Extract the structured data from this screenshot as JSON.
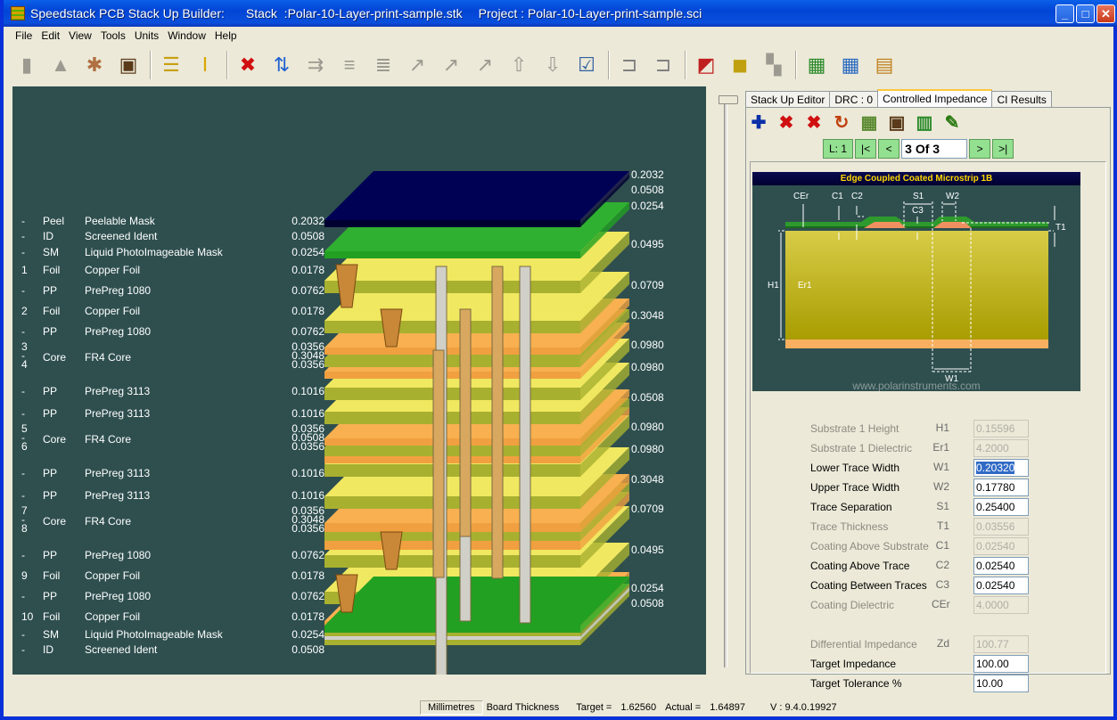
{
  "window": {
    "title_app": "Speedstack PCB Stack Up Builder:",
    "title_stack": "Stack  :Polar-10-Layer-print-sample.stk",
    "title_project": "Project : Polar-10-Layer-print-sample.sci",
    "buttons": {
      "minimize": "_",
      "maximize": "□",
      "close": "✕"
    }
  },
  "menu": [
    "File",
    "Edit",
    "View",
    "Tools",
    "Units",
    "Window",
    "Help"
  ],
  "toolbar": [
    {
      "name": "new-document-icon",
      "glyph": "▮",
      "enabled": false
    },
    {
      "name": "wizard-hat-icon",
      "glyph": "▲",
      "enabled": false
    },
    {
      "name": "vitruvian-man-icon",
      "glyph": "✱",
      "enabled": true
    },
    {
      "name": "frame-icon",
      "glyph": "▣",
      "enabled": true
    },
    {
      "sep": true
    },
    {
      "name": "add-layer-icon",
      "glyph": "☰",
      "enabled": true
    },
    {
      "name": "add-via-icon",
      "glyph": "Ⅰ",
      "enabled": true
    },
    {
      "sep": true
    },
    {
      "name": "delete-icon",
      "glyph": "✖",
      "enabled": true
    },
    {
      "name": "swap-layers-icon",
      "glyph": "⇅",
      "enabled": true
    },
    {
      "name": "move-layer-icon",
      "glyph": "⇉",
      "enabled": false
    },
    {
      "name": "layer-shape-icon",
      "glyph": "≡",
      "enabled": false
    },
    {
      "name": "layer-shape2-icon",
      "glyph": "≣",
      "enabled": false
    },
    {
      "name": "arrow-diag1-icon",
      "glyph": "↗",
      "enabled": false
    },
    {
      "name": "arrow-diag2-icon",
      "glyph": "↗",
      "enabled": false
    },
    {
      "name": "arrow-diag3-icon",
      "glyph": "↗",
      "enabled": false
    },
    {
      "name": "move-up-icon",
      "glyph": "⇧",
      "enabled": false
    },
    {
      "name": "move-down-icon",
      "glyph": "⇩",
      "enabled": false
    },
    {
      "name": "checklist-icon",
      "glyph": "☑",
      "enabled": true
    },
    {
      "sep": true
    },
    {
      "name": "clamp-compress-icon",
      "glyph": "⊐",
      "enabled": true
    },
    {
      "name": "clamp-expand-icon",
      "glyph": "⊐",
      "enabled": true
    },
    {
      "sep": true
    },
    {
      "name": "view-2d-icon",
      "glyph": "◩",
      "enabled": true
    },
    {
      "name": "view-3d-icon",
      "glyph": "◼",
      "enabled": true
    },
    {
      "name": "puzzle-icon",
      "glyph": "▚",
      "enabled": false
    },
    {
      "sep": true
    },
    {
      "name": "export-report-icon",
      "glyph": "▦",
      "enabled": true
    },
    {
      "name": "import-report-icon",
      "glyph": "▦",
      "enabled": true
    },
    {
      "name": "spreadsheet-icon",
      "glyph": "▤",
      "enabled": true
    }
  ],
  "stack": {
    "layers": [
      {
        "num": "-",
        "type": "Peel",
        "material": "Peelable Mask",
        "thickness": "0.2032"
      },
      {
        "num": "-",
        "type": "ID",
        "material": "Screened Ident",
        "thickness": "0.0508"
      },
      {
        "num": "-",
        "type": "SM",
        "material": "Liquid PhotoImageable Mask",
        "thickness": "0.0254"
      },
      {
        "num": "1",
        "type": "Foil",
        "material": "Copper Foil",
        "thickness": "0.0178"
      },
      {
        "num": "-",
        "type": "PP",
        "material": "PrePreg 1080",
        "thickness": "0.0762"
      },
      {
        "num": "2",
        "type": "Foil",
        "material": "Copper Foil",
        "thickness": "0.0178"
      },
      {
        "num": "-",
        "type": "PP",
        "material": "PrePreg 1080",
        "thickness": "0.0762"
      },
      {
        "core": true,
        "nums": [
          "3",
          "-",
          "4"
        ],
        "type": "Core",
        "material": "FR4 Core",
        "thickness": [
          "0.0356",
          "0.3048",
          "0.0356"
        ]
      },
      {
        "num": "-",
        "type": "PP",
        "material": "PrePreg 3113",
        "thickness": "0.1016"
      },
      {
        "num": "-",
        "type": "PP",
        "material": "PrePreg 3113",
        "thickness": "0.1016"
      },
      {
        "core": true,
        "nums": [
          "5",
          "-",
          "6"
        ],
        "type": "Core",
        "material": "FR4 Core",
        "thickness": [
          "0.0356",
          "0.0508",
          "0.0356"
        ]
      },
      {
        "num": "-",
        "type": "PP",
        "material": "PrePreg 3113",
        "thickness": "0.1016"
      },
      {
        "num": "-",
        "type": "PP",
        "material": "PrePreg 3113",
        "thickness": "0.1016"
      },
      {
        "core": true,
        "nums": [
          "7",
          "-",
          "8"
        ],
        "type": "Core",
        "material": "FR4 Core",
        "thickness": [
          "0.0356",
          "0.3048",
          "0.0356"
        ]
      },
      {
        "num": "-",
        "type": "PP",
        "material": "PrePreg 1080",
        "thickness": "0.0762"
      },
      {
        "num": "9",
        "type": "Foil",
        "material": "Copper Foil",
        "thickness": "0.0178"
      },
      {
        "num": "-",
        "type": "PP",
        "material": "PrePreg 1080",
        "thickness": "0.0762"
      },
      {
        "num": "10",
        "type": "Foil",
        "material": "Copper Foil",
        "thickness": "0.0178"
      },
      {
        "num": "-",
        "type": "SM",
        "material": "Liquid PhotoImageable Mask",
        "thickness": "0.0254"
      },
      {
        "num": "-",
        "type": "ID",
        "material": "Screened Ident",
        "thickness": "0.0508"
      }
    ],
    "right_labels": [
      "0.2032",
      "0.0508",
      "0.0254",
      "0.0495",
      "0.0709",
      "0.3048",
      "0.0980",
      "0.0980",
      "0.0508",
      "0.0980",
      "0.0980",
      "0.3048",
      "0.0709",
      "0.0495",
      "0.0254",
      "0.0508"
    ],
    "colors": {
      "background": "#2F4F4F",
      "peel": "#000055",
      "mask": "#22A022",
      "prepreg": "#E8E050",
      "core": "#A8B030",
      "copper": "#F0A040",
      "ident": "#D0D0D0"
    }
  },
  "right_panel": {
    "tabs": [
      {
        "label": "Stack Up Editor",
        "active": false
      },
      {
        "label": "DRC : 0",
        "active": false
      },
      {
        "label": "Controlled Impedance",
        "active": true
      },
      {
        "label": "CI Results",
        "active": false
      }
    ],
    "ci_tools": [
      {
        "name": "add-structure-icon",
        "glyph": "✚",
        "color": "#0A2FA8"
      },
      {
        "name": "delete-structure-icon",
        "glyph": "✖",
        "color": "#D01010"
      },
      {
        "name": "delete-all-icon",
        "glyph": "✖",
        "color": "#D01010"
      },
      {
        "name": "refresh-icon",
        "glyph": "↻",
        "color": "#C04010"
      },
      {
        "name": "structure-thumbnail-icon",
        "glyph": "▦",
        "color": "#5A8A30"
      },
      {
        "name": "frame-icon",
        "glyph": "▣",
        "color": "#5A3A1A"
      },
      {
        "name": "goal-seek-icon",
        "glyph": "▥",
        "color": "#2A8A2A"
      },
      {
        "name": "calculate-icon",
        "glyph": "✎",
        "color": "#2A7A10"
      }
    ],
    "nav": {
      "layer": "L: 1",
      "first": "|<",
      "prev": "<",
      "position": "3 Of 3",
      "next": ">",
      "last": ">|"
    },
    "diagram": {
      "title": "Edge Coupled Coated Microstrip 1B",
      "labels": {
        "CEr": "CEr",
        "C1": "C1",
        "C2": "C2",
        "S1": "S1",
        "C3": "C3",
        "W2": "W2",
        "T1": "T1",
        "H1": "H1",
        "Er1": "Er1",
        "W1": "W1"
      },
      "watermark": "www.polarinstruments.com"
    },
    "params": [
      {
        "label": "Substrate 1 Height",
        "symbol": "H1",
        "value": "0.15596",
        "enabled": false
      },
      {
        "label": "Substrate 1 Dielectric",
        "symbol": "Er1",
        "value": "4.2000",
        "enabled": false
      },
      {
        "label": "Lower Trace Width",
        "symbol": "W1",
        "value": "0.20320",
        "enabled": true,
        "selected": true
      },
      {
        "label": "Upper Trace Width",
        "symbol": "W2",
        "value": "0.17780",
        "enabled": true
      },
      {
        "label": "Trace Separation",
        "symbol": "S1",
        "value": "0.25400",
        "enabled": true
      },
      {
        "label": "Trace Thickness",
        "symbol": "T1",
        "value": "0.03556",
        "enabled": false
      },
      {
        "label": "Coating Above Substrate",
        "symbol": "C1",
        "value": "0.02540",
        "enabled": false
      },
      {
        "label": "Coating Above Trace",
        "symbol": "C2",
        "value": "0.02540",
        "enabled": true
      },
      {
        "label": "Coating Between Traces",
        "symbol": "C3",
        "value": "0.02540",
        "enabled": true
      },
      {
        "label": "Coating Dielectric",
        "symbol": "CEr",
        "value": "4.0000",
        "enabled": false
      },
      {
        "gap": true
      },
      {
        "label": "Differential Impedance",
        "symbol": "Zd",
        "value": "100.77",
        "enabled": false
      },
      {
        "label": "Target Impedance",
        "symbol": "",
        "value": "100.00",
        "enabled": true
      },
      {
        "label": "Target Tolerance %",
        "symbol": "",
        "value": "10.00",
        "enabled": true
      }
    ]
  },
  "status": {
    "units": "Millimetres",
    "board_thickness_label": "Board Thickness",
    "target_label": "Target =",
    "target_value": "1.62560",
    "actual_label": "Actual =",
    "actual_value": "1.64897",
    "version": "V : 9.4.0.19927"
  }
}
